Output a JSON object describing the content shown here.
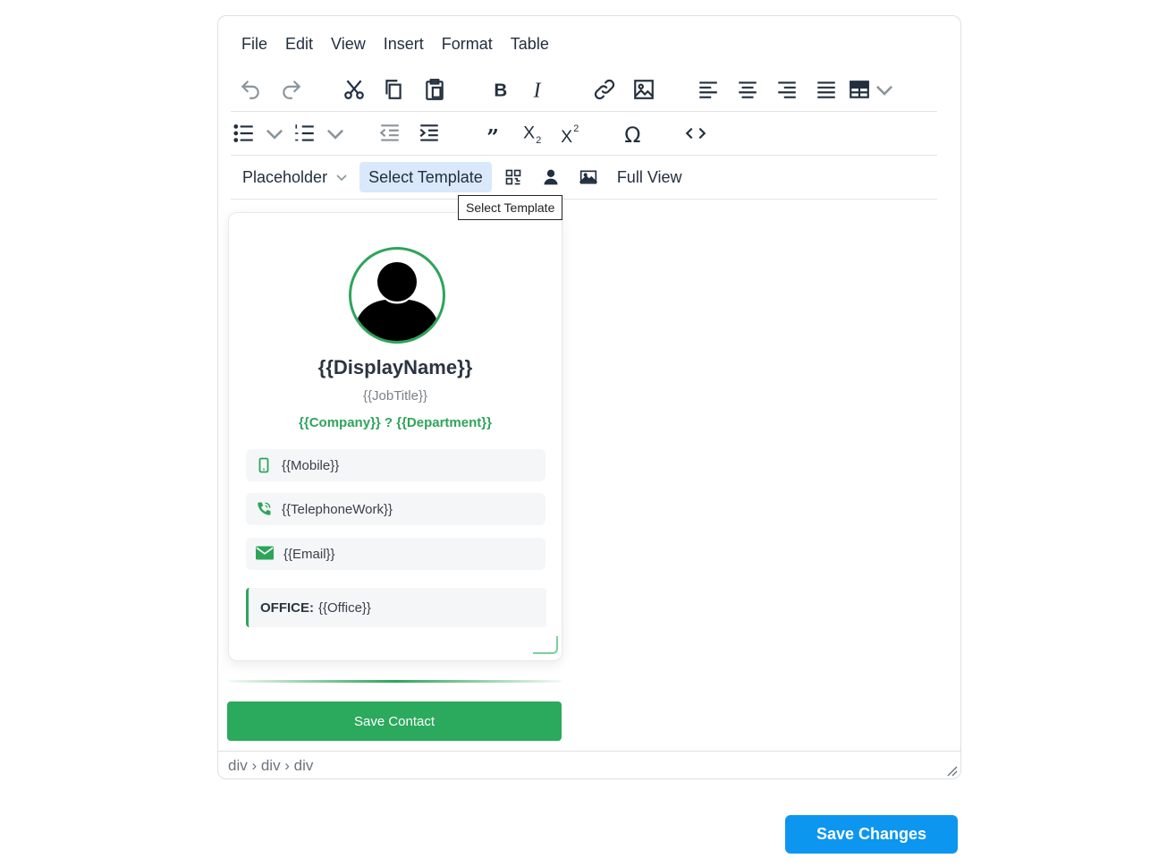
{
  "menubar": [
    "File",
    "Edit",
    "View",
    "Insert",
    "Format",
    "Table"
  ],
  "toolbar": {
    "placeholder_label": "Placeholder",
    "select_template_label": "Select Template",
    "full_view_label": "Full View",
    "tooltip": "Select Template",
    "icons": [
      "undo-icon",
      "redo-icon",
      "cut-icon",
      "copy-icon",
      "paste-icon",
      "bold-icon",
      "italic-icon",
      "link-icon",
      "image-icon",
      "align-left-icon",
      "align-center-icon",
      "align-right-icon",
      "justify-icon",
      "table-icon",
      "bullet-list-icon",
      "numbered-list-icon",
      "outdent-icon",
      "indent-icon",
      "blockquote-icon",
      "subscript-icon",
      "superscript-icon",
      "special-char-icon",
      "source-code-icon",
      "qr-code-icon",
      "user-icon",
      "picture-icon"
    ]
  },
  "card": {
    "name": "{{DisplayName}}",
    "job_title": "{{JobTitle}}",
    "company_line": "{{Company}} ? {{Department}}",
    "fields": [
      {
        "icon": "mobile-icon",
        "value": "{{Mobile}}"
      },
      {
        "icon": "phone-icon",
        "value": "{{TelephoneWork}}"
      },
      {
        "icon": "envelope-icon",
        "value": "{{Email}}"
      }
    ],
    "office_label": "OFFICE:",
    "office_value": "{{Office}}",
    "save_contact_label": "Save Contact",
    "accent_color": "#2ea45a"
  },
  "statusbar": {
    "path": "div › div › div"
  },
  "save_changes_label": "Save Changes",
  "colors": {
    "primary_button": "#0c96f0",
    "green": "#2ba95c",
    "active_bg": "#dae8fb"
  }
}
